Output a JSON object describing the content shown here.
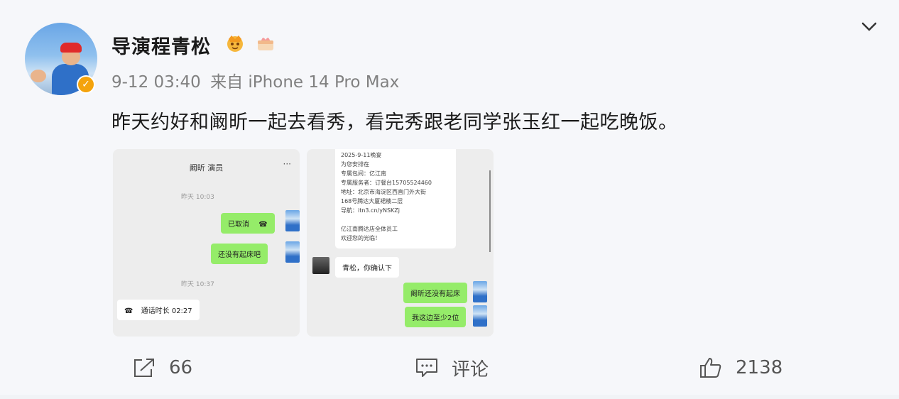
{
  "post": {
    "username": "导演程青松",
    "time": "9-12 03:40",
    "source": "来自 iPhone 14 Pro Max",
    "text": "昨天约好和阚昕一起去看秀，看完秀跟老同学张玉红一起吃晚饭。"
  },
  "icons": [
    "avatar",
    "verified-badge-icon",
    "crown-badge-icon",
    "gift-badge-icon",
    "chevron-down-icon",
    "share-icon",
    "comment-icon",
    "like-icon",
    "phone-icon"
  ],
  "colors": {
    "bubble_green": "#95ec69",
    "verify_badge": "#f4a30c"
  },
  "image1": {
    "title": "阚昕 演员",
    "time1": "昨天 10:03",
    "msg1": "已取消",
    "msg2": "还没有起床吧",
    "time2": "昨天 10:37",
    "msg3": "通话时长 02:27"
  },
  "image2": {
    "card_lines": [
      "2025-9-11晚宴",
      "为您安排在",
      "专属包间：亿江南",
      "专属服务者：订餐台15705524460",
      "地址：北京市海淀区西直门外大街",
      "168号腾达大厦裙楼二层",
      "导航：itn3.cn/yNSKZj",
      "",
      "亿江南腾达店全体员工",
      "欢迎您的光临！"
    ],
    "msg1": "青松，你确认下",
    "msg2": "阚昕还没有起床",
    "msg3": "我这边至少2位"
  },
  "actions": {
    "share_count": "66",
    "comment_label": "评论",
    "like_count": "2138"
  }
}
